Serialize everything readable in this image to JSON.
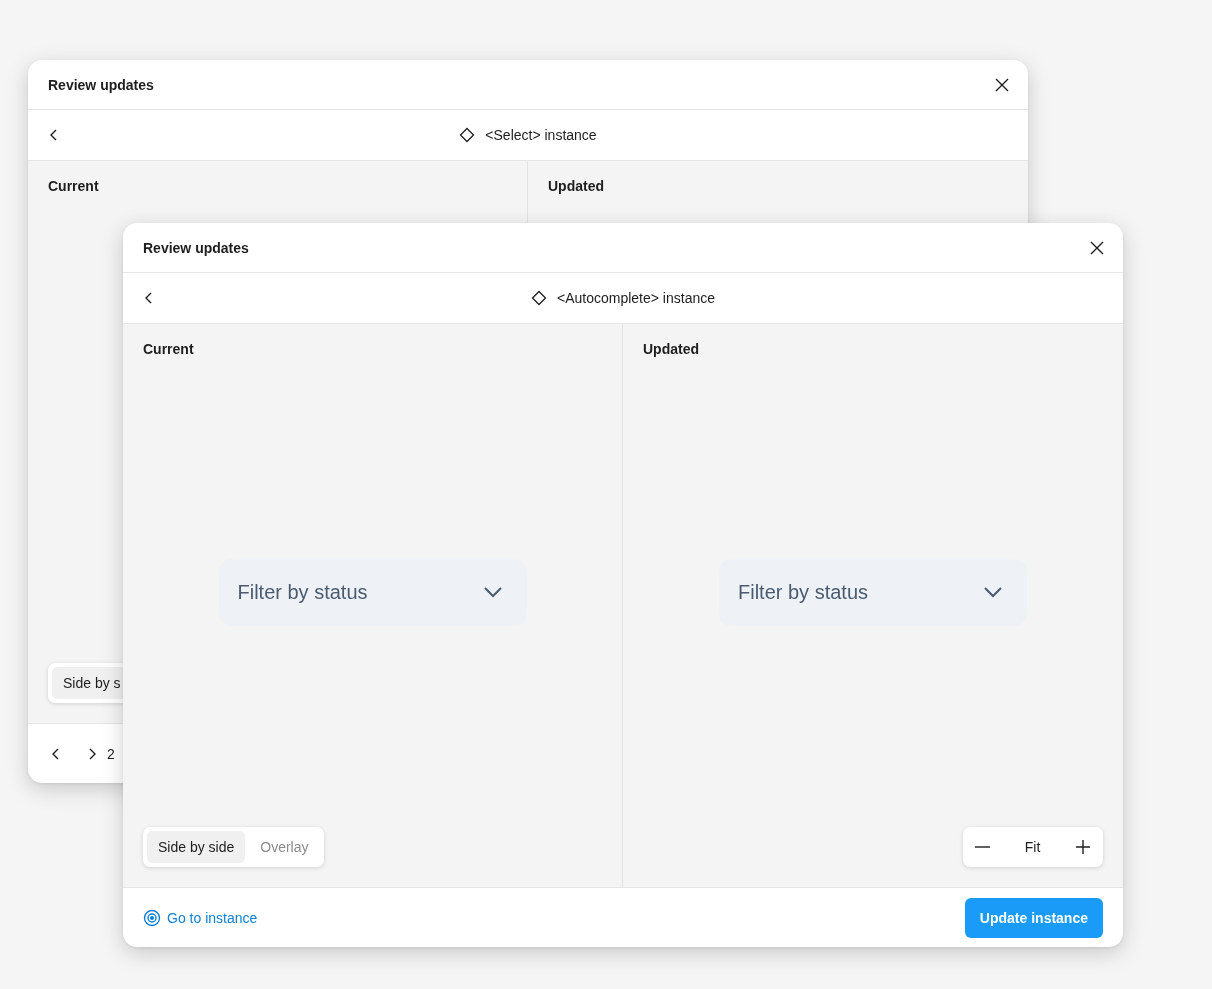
{
  "windows": [
    {
      "title": "Review updates",
      "component": "<Select> instance",
      "panels": [
        {
          "label": "Current",
          "view_modes": [
            {
              "label": "Side by s",
              "selected": true
            }
          ]
        },
        {
          "label": "Updated"
        }
      ],
      "pager": {
        "page": "2"
      }
    },
    {
      "title": "Review updates",
      "component": "<Autocomplete> instance",
      "panels": [
        {
          "label": "Current",
          "preview": {
            "placeholder": "Filter by status"
          },
          "view_modes": [
            {
              "label": "Side by side",
              "selected": true
            },
            {
              "label": "Overlay",
              "selected": false
            }
          ]
        },
        {
          "label": "Updated",
          "preview": {
            "placeholder": "Filter by status"
          },
          "zoom": {
            "label": "Fit"
          }
        }
      ],
      "footer": {
        "link": "Go to instance",
        "action": "Update instance"
      }
    }
  ]
}
